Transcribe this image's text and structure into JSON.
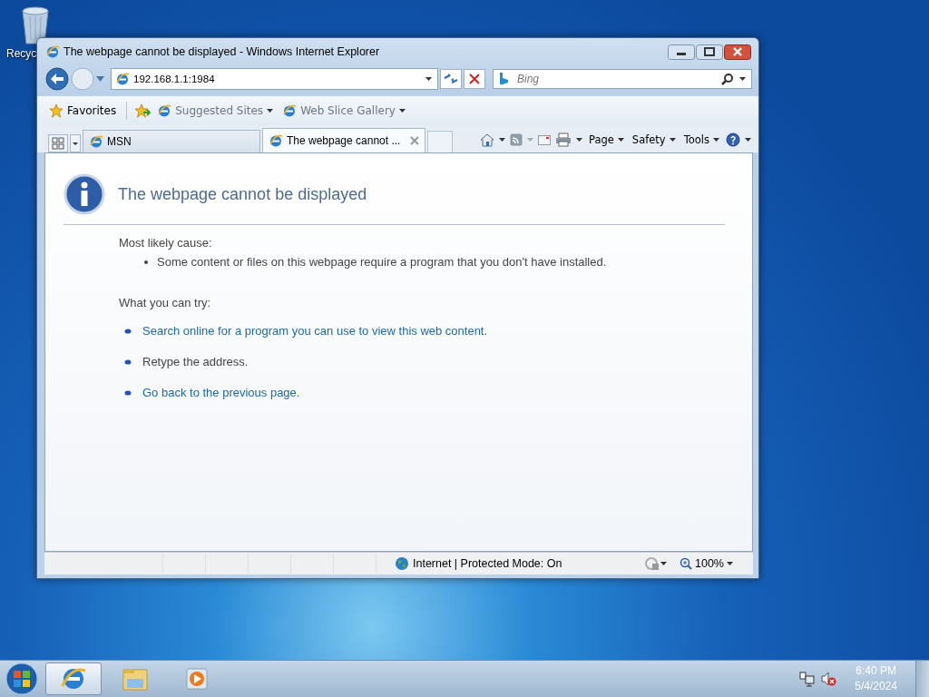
{
  "desktop": {
    "icons": [
      {
        "label": "Recyc"
      }
    ]
  },
  "window": {
    "title": "The webpage cannot be displayed - Windows Internet Explorer",
    "address": "192.168.1.1:1984",
    "search": {
      "placeholder": "Bing"
    },
    "favorites_bar": {
      "favorites": "Favorites",
      "links": [
        "Suggested Sites",
        "Web Slice Gallery"
      ]
    },
    "tabs": [
      {
        "label": "MSN",
        "selected": false
      },
      {
        "label": "The webpage cannot ...",
        "selected": true
      }
    ],
    "command_bar": [
      "Page",
      "Safety",
      "Tools"
    ],
    "page": {
      "heading": "The webpage cannot be displayed",
      "cause_label": "Most likely cause:",
      "causes": [
        "Some content or files on this webpage require a program that you don't have installed."
      ],
      "try_label": "What you can try:",
      "actions": [
        {
          "text": "Search online for a program you can use to view this web content.",
          "kind": "link"
        },
        {
          "text": "Retype the address.",
          "kind": "text"
        },
        {
          "text": "Go back to the previous page.",
          "kind": "link"
        }
      ]
    },
    "status_bar": {
      "zone": "Internet | Protected Mode: On",
      "zoom": "100%"
    }
  },
  "taskbar": {
    "items": [
      {
        "kind": "browser",
        "selected": true
      },
      {
        "kind": "folder",
        "selected": false
      },
      {
        "kind": "media",
        "selected": false
      }
    ],
    "clock": {
      "time": "6:40 PM",
      "date": "5/4/2024"
    }
  }
}
